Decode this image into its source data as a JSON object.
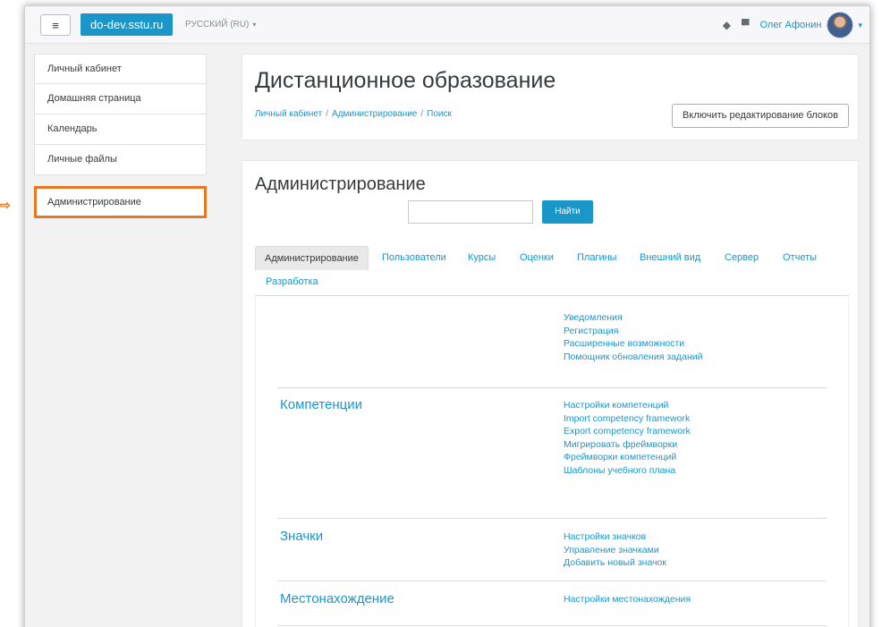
{
  "navbar": {
    "menu_icon": "hamburger-icon",
    "brand": "do-dev.sstu.ru",
    "language": "РУССКИЙ (RU)",
    "user_name": "Олег Афонин"
  },
  "sidebar": {
    "items": [
      {
        "label": "Личный кабинет"
      },
      {
        "label": "Домашняя страница"
      },
      {
        "label": "Календарь"
      },
      {
        "label": "Личные файлы"
      }
    ],
    "admin_label": "Администрирование",
    "highlight_color": "#e87722"
  },
  "header": {
    "title": "Дистанционное образование",
    "breadcrumb": [
      "Личный кабинет",
      "Администрирование",
      "Поиск"
    ],
    "edit_button": "Включить редактирование блоков"
  },
  "admin": {
    "title": "Администрирование",
    "search_value": "",
    "search_button": "Найти",
    "tabs": [
      {
        "label": "Администрирование",
        "active": true
      },
      {
        "label": "Пользователи"
      },
      {
        "label": "Курсы"
      },
      {
        "label": "Оценки"
      },
      {
        "label": "Плагины"
      },
      {
        "label": "Внешний вид"
      },
      {
        "label": "Сервер"
      },
      {
        "label": "Отчеты"
      },
      {
        "label": "Разработка"
      }
    ],
    "sections": [
      {
        "title": "",
        "links": [
          "Уведомления",
          "Регистрация",
          "Расширенные возможности",
          "Помощник обновления заданий"
        ]
      },
      {
        "title": "Компетенции",
        "links": [
          "Настройки компетенций",
          "Import competency framework",
          "Export competency framework",
          "Мигрировать фреймворки",
          "Фреймворки компетенций",
          "Шаблоны учебного плана"
        ]
      },
      {
        "title": "Значки",
        "links": [
          "Настройки значков",
          "Управление значками",
          "Добавить новый значок"
        ]
      },
      {
        "title": "Местонахождение",
        "links": [
          "Настройки местонахождения"
        ]
      }
    ]
  },
  "colors": {
    "accent": "#1a96c9",
    "highlight": "#e87722"
  }
}
